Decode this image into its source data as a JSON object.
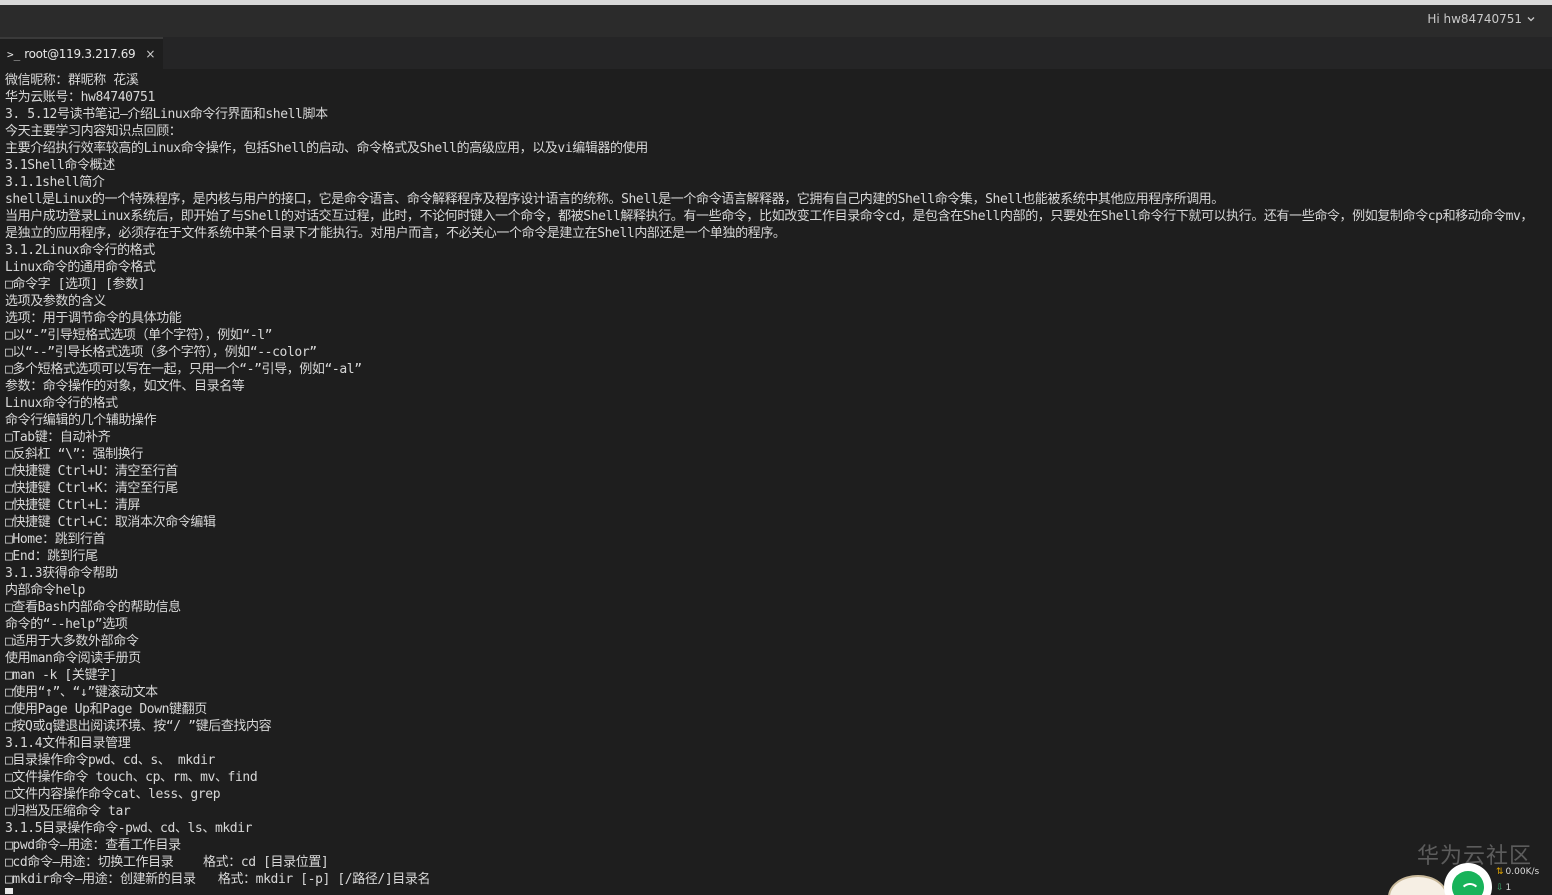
{
  "header": {
    "user_greeting": "Hi hw84740751"
  },
  "tab": {
    "prompt_glyph": ">_",
    "title": "root@119.3.217.69",
    "close_glyph": "×"
  },
  "terminal": {
    "lines": [
      "微信昵称：群昵称 花溪",
      "华为云账号：hw84740751",
      "3. 5.12号读书笔记—介绍Linux命令行界面和shell脚本",
      "今天主要学习内容知识点回顾：",
      "主要介绍执行效率较高的Linux命令操作，包括Shell的启动、命令格式及Shell的高级应用，以及vi编辑器的使用",
      "3.1Shell命令概述",
      "3.1.1shell简介",
      "shell是Linux的一个特殊程序，是内核与用户的接口，它是命令语言、命令解释程序及程序设计语言的统称。Shell是一个命令语言解释器，它拥有自己内建的Shell命令集，Shell也能被系统中其他应用程序所调用。",
      "当用户成功登录Linux系统后，即开始了与Shell的对话交互过程，此时，不论何时键入一个命令，都被Shell解释执行。有一些命令，比如改变工作目录命令cd，是包含在Shell内部的，只要处在Shell命令行下就可以执行。还有一些命令，例如复制命令cp和移动命令mv，是独立的应用程序，必须存在于文件系统中某个目录下才能执行。对用户而言，不必关心一个命令是建立在Shell内部还是一个单独的程序。",
      "3.1.2Linux命令行的格式",
      "Linux命令的通用命令格式",
      "□命令字 [选项] [参数]",
      "选项及参数的含义",
      "选项：用于调节命令的具体功能",
      "□以“-”引导短格式选项（单个字符），例如“-l”",
      "□以“--”引导长格式选项（多个字符），例如“--color”",
      "□多个短格式选项可以写在一起，只用一个“-”引导，例如“-al”",
      "参数：命令操作的对象，如文件、目录名等",
      "Linux命令行的格式",
      "命令行编辑的几个辅助操作",
      "□Tab键：自动补齐",
      "□反斜杠 “\\”：强制换行",
      "□快捷键 Ctrl+U：清空至行首",
      "□快捷键 Ctrl+K：清空至行尾",
      "□快捷键 Ctrl+L：清屏",
      "□快捷键 Ctrl+C：取消本次命令编辑",
      "□Home：跳到行首",
      "□End：跳到行尾",
      "3.1.3获得命令帮助",
      "内部命令help",
      "□查看Bash内部命令的帮助信息",
      "命令的“--help”选项",
      "□适用于大多数外部命令",
      "使用man命令阅读手册页",
      "□man -k [关键字]",
      "□使用“↑”、“↓”键滚动文本",
      "□使用Page Up和Page Down键翻页",
      "□按Q或q键退出阅读环境、按“/ ”键后查找内容",
      "3.1.4文件和目录管理",
      "□目录操作命令pwd、cd、s、 mkdir",
      "□文件操作命令 touch、cp、rm、mv、find",
      "□文件内容操作命令cat、less、grep",
      "□归档及压缩命令 tar",
      "3.1.5目录操作命令-pwd、cd、ls、mkdir",
      "□pwd命令—用途：查看工作目录",
      "□cd命令—用途：切换工作目录    格式：cd [目录位置]",
      "□mkdir命令—用途：创建新的目录   格式：mkdir [-p] [/路径/]目录名"
    ]
  },
  "watermark": "华为云社区",
  "net_widget": {
    "upload_speed": "0.00K/s",
    "download_speed": "1"
  },
  "colors": {
    "terminal_bg": "#1e1e1e",
    "terminal_fg": "#d8d8d8",
    "titlebar_bg": "#2b2b2b",
    "tabbar_bg": "#252526"
  }
}
